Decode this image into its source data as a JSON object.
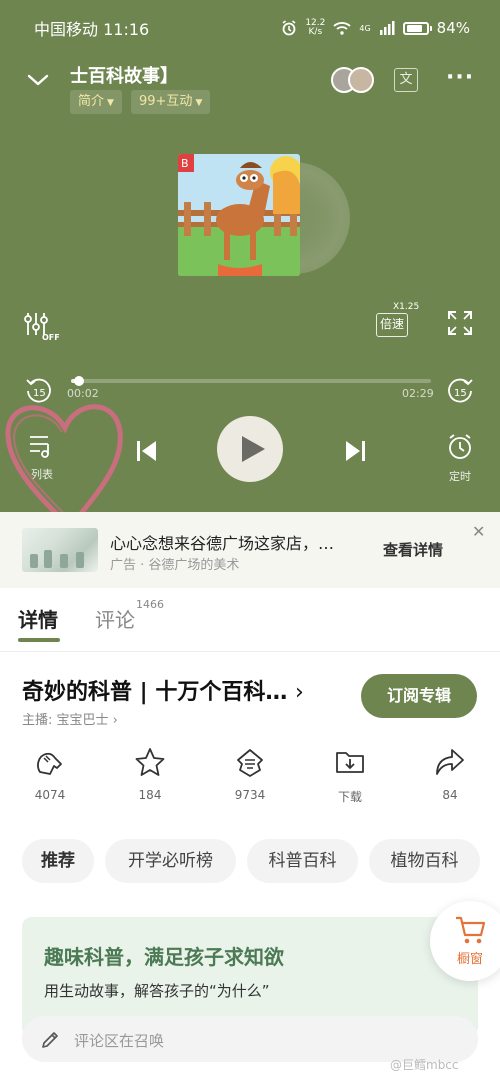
{
  "status_bar": {
    "carrier_time": "中国移动 11:16",
    "net_speed_value": "12.2",
    "net_speed_unit": "K/s",
    "network": "4G",
    "battery": "84%"
  },
  "player": {
    "album_title": "士百科故事】",
    "chips": [
      {
        "label": "简介"
      },
      {
        "label": "99+互动"
      }
    ],
    "text_toggle": "文",
    "speed_label": "倍速",
    "speed_value": "X1.25",
    "skip_seconds": "15",
    "time_current": "00:02",
    "time_total": "02:29",
    "progress_fraction": 0.013,
    "list_label": "列表",
    "timer_label": "定时"
  },
  "ad": {
    "title": "心心念想来谷德广场这家店，…",
    "subtitle": "广告 · 谷德广场的美术",
    "cta": "查看详情"
  },
  "tabs": {
    "details": "详情",
    "comments": "评论",
    "comments_count": "1466"
  },
  "album": {
    "name": "奇妙的科普 | 十万个百科…",
    "anchor": "主播:  宝宝巴士",
    "subscribe": "订阅专辑"
  },
  "stats": [
    {
      "icon": "like-icon",
      "label": "4074"
    },
    {
      "icon": "star-icon",
      "label": "184"
    },
    {
      "icon": "ticket-icon",
      "label": "9734"
    },
    {
      "icon": "download-icon",
      "label": "下载"
    },
    {
      "icon": "share-icon",
      "label": "84"
    }
  ],
  "tags": [
    {
      "label": "推荐"
    },
    {
      "label": "开学必听榜"
    },
    {
      "label": "科普百科"
    },
    {
      "label": "植物百科"
    }
  ],
  "promo": {
    "title": "趣味科普，满足孩子求知欲",
    "subtitle": "用生动故事，解答孩子的“为什么”"
  },
  "shop": {
    "label": "橱窗"
  },
  "comment_bar": {
    "placeholder": "评论区在召唤"
  },
  "watermark": "@巨鳕mbcc",
  "colors": {
    "player_bg": "#6f8550",
    "accent": "#6f8550",
    "chip_text": "#f2e6a6",
    "shop_orange": "#e4733a",
    "heart": "#d96a86"
  }
}
